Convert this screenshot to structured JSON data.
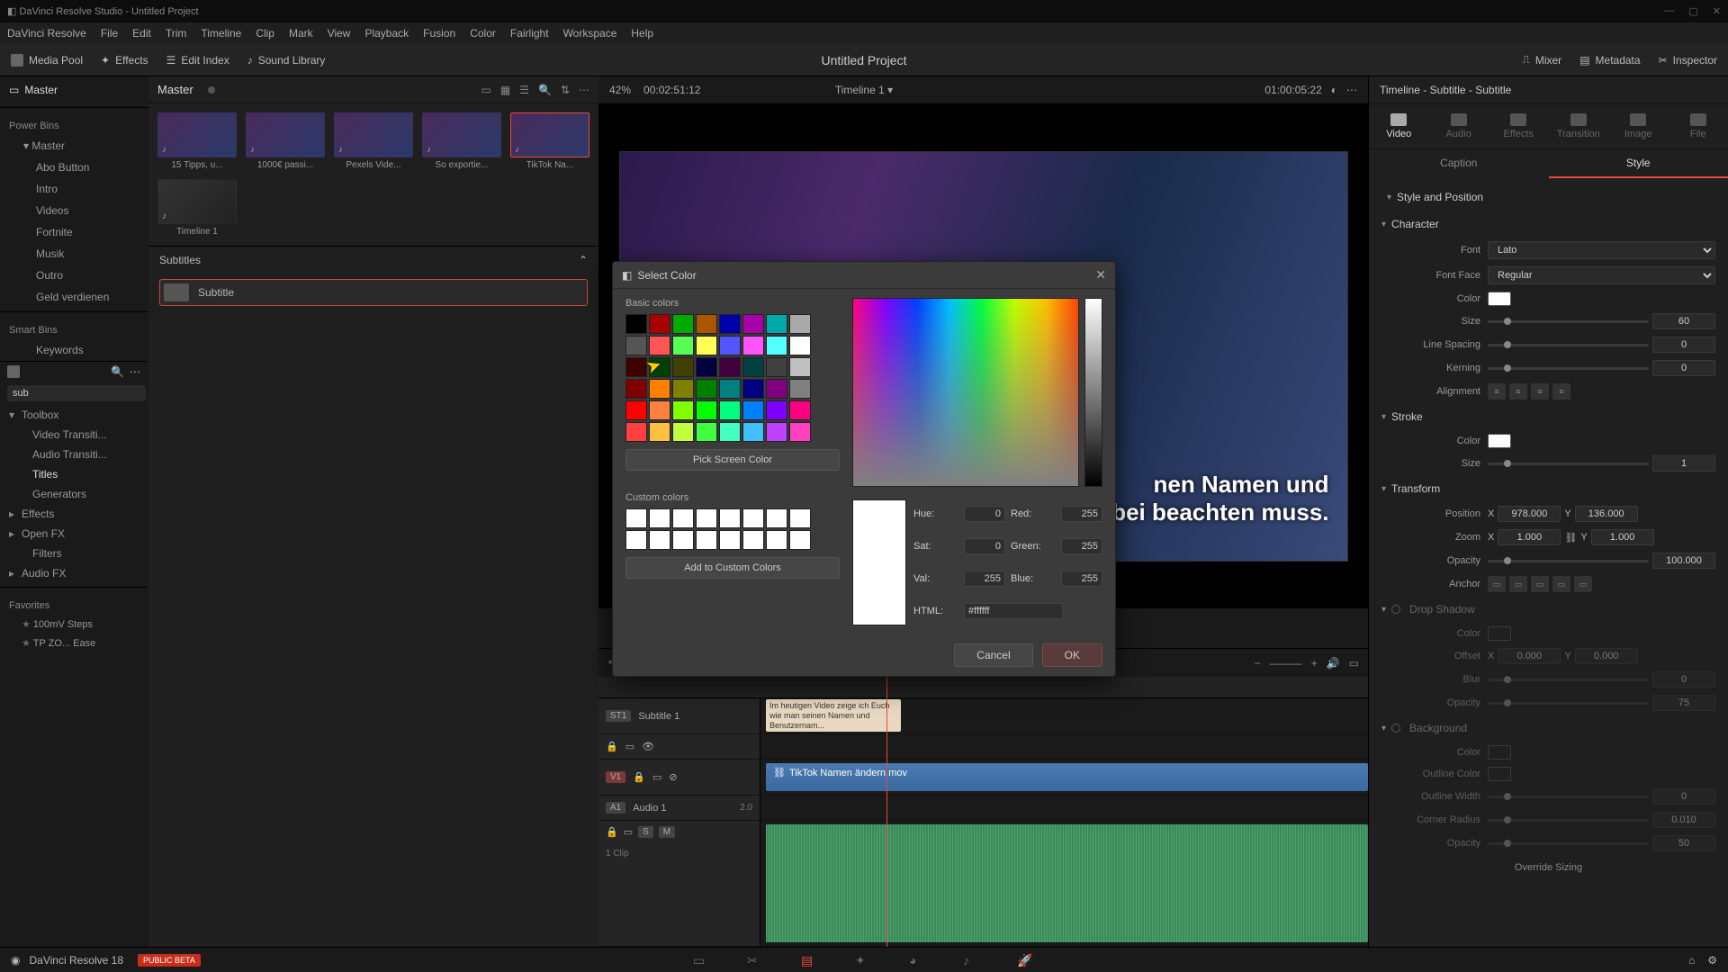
{
  "titlebar": {
    "text": "DaVinci Resolve Studio - Untitled Project"
  },
  "menu": [
    "DaVinci Resolve",
    "File",
    "Edit",
    "Trim",
    "Timeline",
    "Clip",
    "Mark",
    "View",
    "Playback",
    "Fusion",
    "Color",
    "Fairlight",
    "Workspace",
    "Help"
  ],
  "toolbar": {
    "media_pool": "Media Pool",
    "effects": "Effects",
    "edit_index": "Edit Index",
    "sound_library": "Sound Library",
    "mixer": "Mixer",
    "metadata": "Metadata",
    "inspector": "Inspector",
    "project_title": "Untitled Project"
  },
  "bins": {
    "master": "Master",
    "power_label": "Power Bins",
    "pb_master": "Master",
    "pb_items": [
      "Abo Button",
      "Intro",
      "Videos",
      "Fortnite",
      "Musik",
      "Outro",
      "Geld verdienen"
    ],
    "smart_label": "Smart Bins",
    "sb_items": [
      "Keywords"
    ]
  },
  "media_header": {
    "title": "Master"
  },
  "thumbs": [
    {
      "label": "15 Tipps, u..."
    },
    {
      "label": "1000€ passi..."
    },
    {
      "label": "Pexels Vide..."
    },
    {
      "label": "So exportie..."
    },
    {
      "label": "TikTok Na...",
      "sel": true
    },
    {
      "label": "Timeline 1",
      "tl": true
    }
  ],
  "subtitles_panel": {
    "header": "Subtitles",
    "item": "Subtitle"
  },
  "search": {
    "value": "sub"
  },
  "toolbox": {
    "root": "Toolbox",
    "items": [
      "Video Transiti...",
      "Audio Transiti...",
      "Titles",
      "Generators"
    ],
    "effects": "Effects",
    "openfx": "Open FX",
    "filters": "Filters",
    "audiofx": "Audio FX",
    "fav_label": "Favorites",
    "favs": [
      "100mV Steps",
      "TP ZO... Ease"
    ]
  },
  "viewer": {
    "zoom": "42%",
    "tc_left": "00:02:51:12",
    "heading": "Timeline 1",
    "tc_right": "01:00:05:22",
    "sub1": "nen Namen und",
    "sub2": "rbei beachten muss."
  },
  "timeline": {
    "sub_track": "Subtitle 1",
    "sub_text": "Im heutigen Video zeige ich Euch wie man seinen Namen und Benutzernam...",
    "v1": "V1",
    "video_clip": "TikTok Namen ändern.mov",
    "a1": "A1",
    "a1_name": "Audio 1",
    "a1_ch": "2.0",
    "a1_clip": "1 Clip"
  },
  "inspector": {
    "header": "Timeline - Subtitle - Subtitle",
    "tabs": [
      "Video",
      "Audio",
      "Effects",
      "Transition",
      "Image",
      "File"
    ],
    "subtabs": [
      "Caption",
      "Style"
    ],
    "style_pos": "Style and Position",
    "character": "Character",
    "font_lbl": "Font",
    "font": "Lato",
    "face_lbl": "Font Face",
    "face": "Regular",
    "color_lbl": "Color",
    "size_lbl": "Size",
    "size": "60",
    "ls_lbl": "Line Spacing",
    "ls": "0",
    "kern_lbl": "Kerning",
    "kern": "0",
    "align_lbl": "Alignment",
    "stroke": "Stroke",
    "stroke_color_lbl": "Color",
    "stroke_size_lbl": "Size",
    "stroke_size": "1",
    "transform": "Transform",
    "pos_lbl": "Position",
    "pos_x": "978.000",
    "pos_y": "136.000",
    "zoom_lbl": "Zoom",
    "zoom_x": "1.000",
    "zoom_y": "1.000",
    "opacity_lbl": "Opacity",
    "opacity": "100.000",
    "anchor_lbl": "Anchor",
    "drop": "Drop Shadow",
    "ds_color_lbl": "Color",
    "ds_off_lbl": "Offset",
    "ds_off_x": "0.000",
    "ds_off_y": "0.000",
    "ds_blur_lbl": "Blur",
    "ds_blur": "0",
    "ds_op_lbl": "Opacity",
    "ds_op": "75",
    "bg": "Background",
    "bg_color_lbl": "Color",
    "bg_outline_lbl": "Outline Color",
    "bg_ow_lbl": "Outline Width",
    "bg_ow": "0",
    "bg_cr_lbl": "Corner Radius",
    "bg_cr": "0.010",
    "bg_op_lbl": "Opacity",
    "bg_op": "50",
    "override": "Override Sizing"
  },
  "dialog": {
    "title": "Select Color",
    "basic": "Basic colors",
    "pick": "Pick Screen Color",
    "custom": "Custom colors",
    "add": "Add to Custom Colors",
    "hue_lbl": "Hue:",
    "hue": "0",
    "sat_lbl": "Sat:",
    "sat": "0",
    "val_lbl": "Val:",
    "val": "255",
    "red_lbl": "Red:",
    "red": "255",
    "green_lbl": "Green:",
    "green": "255",
    "blue_lbl": "Blue:",
    "blue": "255",
    "html_lbl": "HTML:",
    "html": "#ffffff",
    "cancel": "Cancel",
    "ok": "OK"
  },
  "basic_colors": [
    "#000000",
    "#aa0000",
    "#00aa00",
    "#aa5500",
    "#0000aa",
    "#aa00aa",
    "#00aaaa",
    "#aaaaaa",
    "#555555",
    "#ff5555",
    "#55ff55",
    "#ffff55",
    "#5555ff",
    "#ff55ff",
    "#55ffff",
    "#ffffff",
    "#400000",
    "#004000",
    "#404000",
    "#000040",
    "#400040",
    "#004040",
    "#404040",
    "#c0c0c0",
    "#800000",
    "#ff8000",
    "#808000",
    "#008000",
    "#008080",
    "#000080",
    "#800080",
    "#808080",
    "#ff0000",
    "#ff8040",
    "#80ff00",
    "#00ff00",
    "#00ff80",
    "#0080ff",
    "#8000ff",
    "#ff0080",
    "#ff4040",
    "#ffc040",
    "#c0ff40",
    "#40ff40",
    "#40ffc0",
    "#40c0ff",
    "#c040ff",
    "#ff40c0"
  ],
  "bottom": {
    "app": "DaVinci Resolve 18",
    "beta": "PUBLIC BETA"
  }
}
